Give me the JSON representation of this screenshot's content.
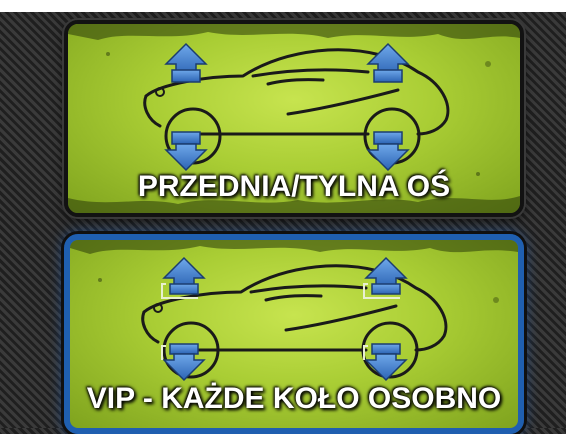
{
  "modes": [
    {
      "id": "axle",
      "label": "PRZEDNIA/TYLNA OŚ",
      "selected": false,
      "icon": "car-outline-icon"
    },
    {
      "id": "vip",
      "label": "VIP - KAŻDE KOŁO OSOBNO",
      "selected": true,
      "icon": "car-outline-icon"
    }
  ],
  "colors": {
    "card_green": "#a9cd34",
    "arrow_blue": "#3f7fd0",
    "selected_border": "#1f5fb0",
    "background": "#2a2a2a"
  }
}
